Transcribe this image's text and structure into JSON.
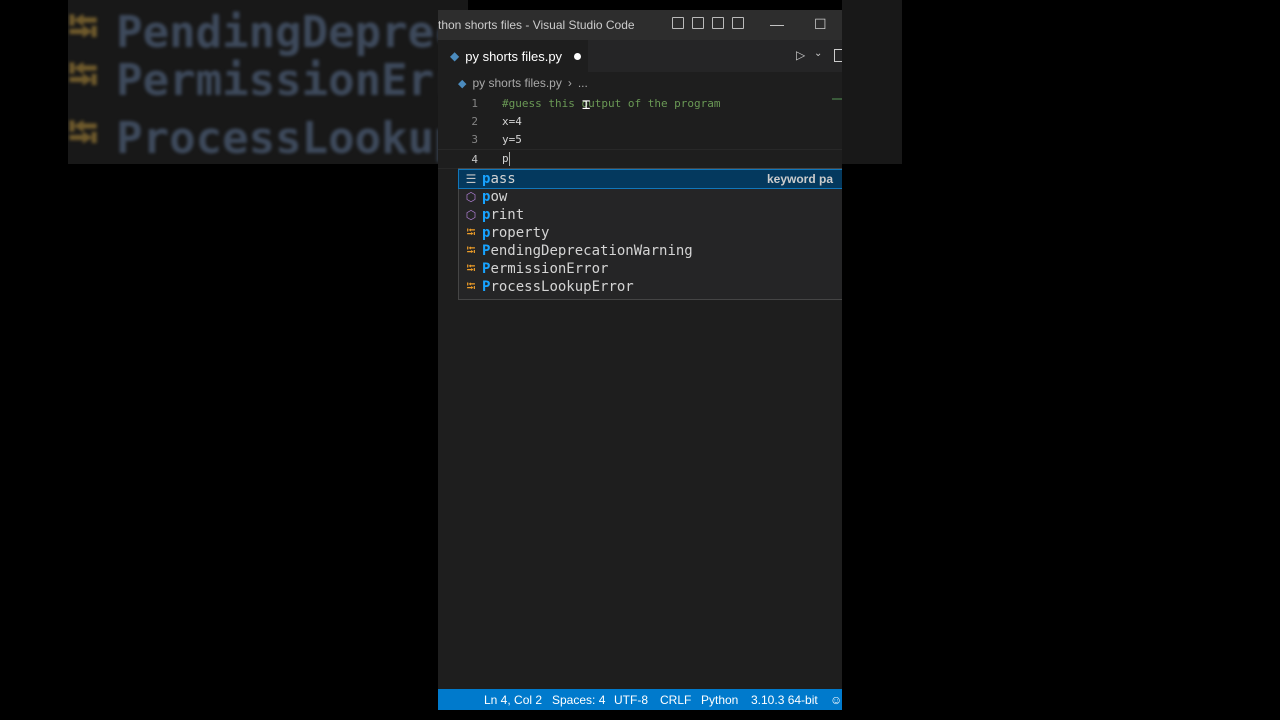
{
  "background": {
    "zoom_rows": [
      {
        "text": "PendingDeprecationWarning",
        "icon": "class-icon"
      },
      {
        "text": "PermissionError",
        "icon": "class-icon"
      },
      {
        "text": "ProcessLookupError",
        "icon": "class-icon"
      }
    ]
  },
  "window": {
    "title": "thon shorts files - Visual Studio Code",
    "controls": {
      "minimize": "—",
      "maximize": "☐"
    }
  },
  "tab": {
    "label": "py shorts files.py",
    "modified": true,
    "icon": "python-file-icon"
  },
  "breadcrumb": {
    "file": "py shorts files.py",
    "more": "..."
  },
  "editor": {
    "lines": [
      {
        "number": "1",
        "text": "#guess this output of the program",
        "kind": "comment"
      },
      {
        "number": "2",
        "text": "x=4",
        "kind": "code"
      },
      {
        "number": "3",
        "text": "y=5",
        "kind": "code"
      },
      {
        "number": "4",
        "text": "p",
        "kind": "code"
      }
    ]
  },
  "suggestions": {
    "items": [
      {
        "match": "p",
        "rest": "ass",
        "kind": "keyword-icon",
        "detail": "keyword pa",
        "selected": true
      },
      {
        "match": "p",
        "rest": "ow",
        "kind": "method-icon"
      },
      {
        "match": "p",
        "rest": "rint",
        "kind": "method-icon"
      },
      {
        "match": "p",
        "rest": "roperty",
        "kind": "class-icon"
      },
      {
        "match": "P",
        "rest": "endingDeprecationWarning",
        "kind": "class-icon"
      },
      {
        "match": "P",
        "rest": "ermissionError",
        "kind": "class-icon"
      },
      {
        "match": "P",
        "rest": "rocessLookupError",
        "kind": "class-icon"
      }
    ]
  },
  "statusbar": {
    "position": "Ln 4, Col 2",
    "spaces": "Spaces: 4",
    "encoding": "UTF-8",
    "eol": "CRLF",
    "language": "Python",
    "interpreter": "3.10.3 64-bit"
  },
  "colors": {
    "accent": "#007acc",
    "selection": "#04395e",
    "match": "#18a3ff",
    "comment": "#6a9955"
  }
}
